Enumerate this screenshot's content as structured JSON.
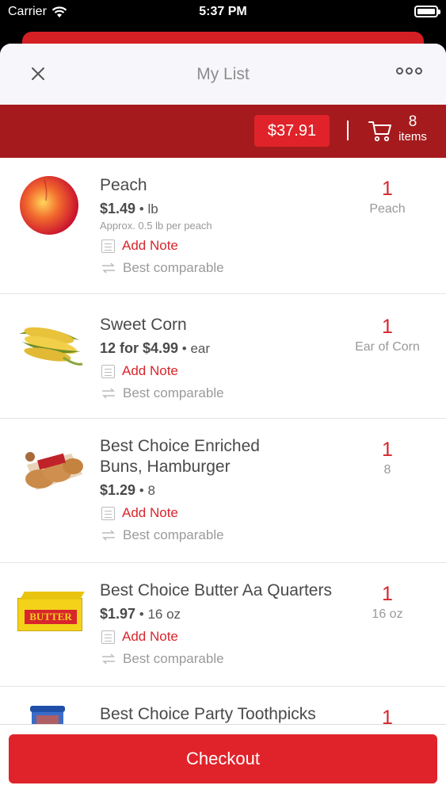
{
  "status_bar": {
    "carrier": "Carrier",
    "time": "5:37 PM"
  },
  "nav": {
    "title": "My List"
  },
  "summary": {
    "total": "$37.91",
    "item_count": "8",
    "item_label": "items"
  },
  "items": [
    {
      "name": "Peach",
      "price": "$1.49",
      "unit": "lb",
      "approx": "Approx. 0.5 lb per peach",
      "note_label": "Add Note",
      "comparable_label": "Best comparable",
      "qty": "1",
      "qty_unit": "Peach"
    },
    {
      "name": "Sweet Corn",
      "price": "12 for $4.99",
      "unit": "ear",
      "note_label": "Add Note",
      "comparable_label": "Best comparable",
      "qty": "1",
      "qty_unit": "Ear of Corn"
    },
    {
      "name": "Best Choice Enriched Buns, Hamburger",
      "price": "$1.29",
      "unit": "8",
      "note_label": "Add Note",
      "comparable_label": "Best comparable",
      "qty": "1",
      "qty_unit": "8"
    },
    {
      "name": "Best Choice Butter Aa Quarters",
      "price": "$1.97",
      "unit": "16 oz",
      "note_label": "Add Note",
      "comparable_label": "Best comparable",
      "qty": "1",
      "qty_unit": "16 oz",
      "image_text": "BUTTER"
    },
    {
      "name": "Best Choice Party Toothpicks",
      "qty": "1"
    }
  ],
  "checkout": {
    "label": "Checkout"
  },
  "colors": {
    "brand_red": "#e0232a",
    "dark_red": "#a51b1d"
  }
}
